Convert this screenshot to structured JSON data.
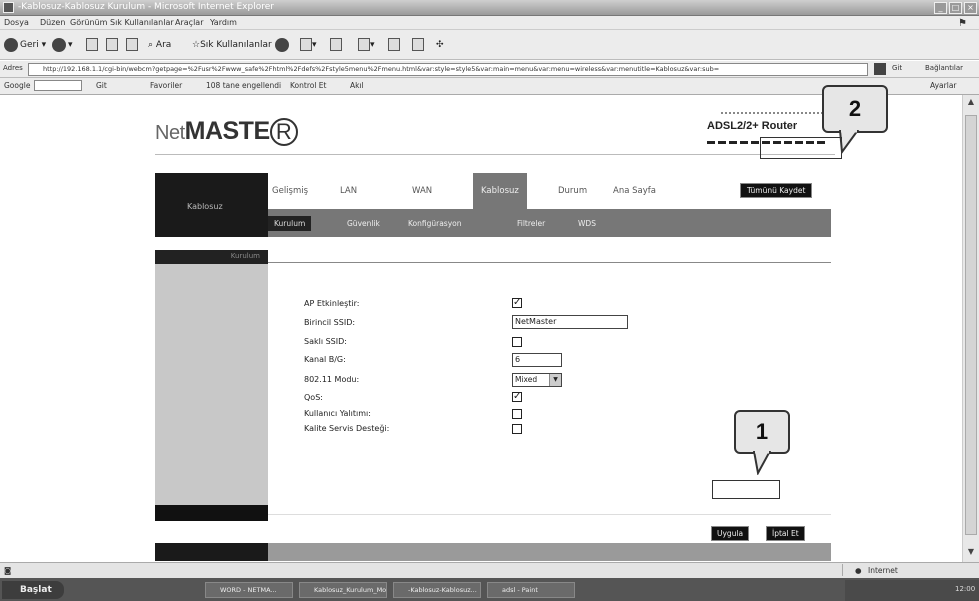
{
  "window": {
    "title": "-Kablosuz-Kablosuz Kurulum - Microsoft Internet Explorer"
  },
  "menu": [
    "Dosya",
    "Düzen",
    "Görünüm",
    "Sık Kullanılanlar",
    "Araçlar",
    "Yardım"
  ],
  "toolbar": {
    "back": "Geri",
    "search": "Ara",
    "favorites": "Sık Kullanılanlar"
  },
  "address": {
    "label": "Adres",
    "url": "http://192.168.1.1/cgi-bin/webcm?getpage=%2Fusr%2Fwww_safe%2Fhtml%2Fdefs%2Fstyle5menu%2Fmenu.html&var:style=style5&var:main=menu&var:menu=wireless&var:menutitle=Kablosuz&var:sub=",
    "go": "Git",
    "links": "Bağlantılar"
  },
  "linksbar": {
    "google": "Google",
    "go": "Git",
    "favorites": "Favoriler",
    "blocked": "108 tane engellendi",
    "spell": "Kontrol Et",
    "translate": "Akıl",
    "settings": "Ayarlar"
  },
  "brand": {
    "net": "Net",
    "master": "MASTE",
    "r": "R",
    "product": "ADSL2/2+ Router"
  },
  "sidebar": {
    "heading": "Kablosuz",
    "section": "Kurulum"
  },
  "nav": {
    "tabs": [
      "Gelişmiş",
      "LAN",
      "WAN",
      "Kablosuz",
      "Durum",
      "Ana Sayfa"
    ],
    "active_tab": "Kablosuz",
    "save_all": "Tümünü Kaydet"
  },
  "subnav": {
    "items": [
      "Kurulum",
      "Güvenlik",
      "Konfigürasyon",
      "Filtreler",
      "WDS"
    ],
    "active": "Kurulum"
  },
  "form": {
    "ap_enable_label": "AP Etkinleştir:",
    "ap_enable_checked": true,
    "ssid1_label": "Birincil SSID:",
    "ssid1_value": "NetMaster",
    "hide_ssid_label": "Saklı SSID:",
    "hide_ssid_checked": false,
    "channel_label": "Kanal B/G:",
    "channel_value": "6",
    "mode_label": "802.11 Modu:",
    "mode_value": "Mixed",
    "qos_label": "QoS:",
    "qos_checked": true,
    "user_isolation_label": "Kullanıcı Yalıtımı:",
    "user_isolation_checked": false,
    "wmm_label": "Kalite Servis Desteği:",
    "wmm_checked": false
  },
  "buttons": {
    "apply": "Uygula",
    "cancel": "İptal Et"
  },
  "callouts": {
    "one": "1",
    "two": "2"
  },
  "status": {
    "zone": "Internet"
  },
  "taskbar": {
    "start": "Başlat",
    "tasks": [
      "WORD - NETMA...",
      "Kablosuz_Kurulum_Mo...",
      "-Kablosuz-Kablosuz...",
      "adsl - Paint"
    ],
    "clock": "12:00"
  },
  "colors": {
    "nav_active": "#777777",
    "sidebar_dark": "#1a1a1a",
    "side_panel": "#c8c8c8"
  }
}
